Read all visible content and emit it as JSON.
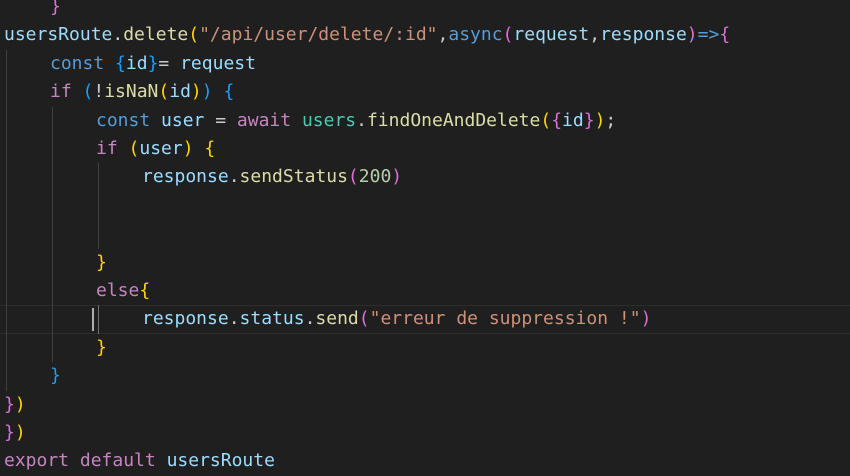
{
  "editor": {
    "lines": [
      {
        "indent": 1,
        "tokens": [
          {
            "t": "}",
            "c": "b2"
          }
        ]
      },
      {
        "indent": 0,
        "tokens": [
          {
            "t": "usersRoute",
            "c": "t-var"
          },
          {
            "t": ".",
            "c": "t-p"
          },
          {
            "t": "delete",
            "c": "t-fn"
          },
          {
            "t": "(",
            "c": "b1"
          },
          {
            "t": "\"/api/user/delete/:id\"",
            "c": "t-str"
          },
          {
            "t": ",",
            "c": "t-p"
          },
          {
            "t": "async",
            "c": "t-kw"
          },
          {
            "t": "(",
            "c": "b2"
          },
          {
            "t": "request",
            "c": "t-var"
          },
          {
            "t": ",",
            "c": "t-p"
          },
          {
            "t": "response",
            "c": "t-var"
          },
          {
            "t": ")",
            "c": "b2"
          },
          {
            "t": "=>",
            "c": "t-kw"
          },
          {
            "t": "{",
            "c": "b2"
          }
        ]
      },
      {
        "indent": 1,
        "tokens": [
          {
            "t": "const ",
            "c": "t-kw"
          },
          {
            "t": "{",
            "c": "b3"
          },
          {
            "t": "id",
            "c": "t-var"
          },
          {
            "t": "}",
            "c": "b3"
          },
          {
            "t": "= ",
            "c": "t-p"
          },
          {
            "t": "request",
            "c": "t-var"
          }
        ]
      },
      {
        "indent": 1,
        "tokens": [
          {
            "t": "if ",
            "c": "t-ctl"
          },
          {
            "t": "(",
            "c": "b3"
          },
          {
            "t": "!",
            "c": "t-p"
          },
          {
            "t": "isNaN",
            "c": "t-fn"
          },
          {
            "t": "(",
            "c": "b1"
          },
          {
            "t": "id",
            "c": "t-var"
          },
          {
            "t": ")",
            "c": "b1"
          },
          {
            "t": ") ",
            "c": "b3"
          },
          {
            "t": "{",
            "c": "b3"
          }
        ]
      },
      {
        "indent": 2,
        "tokens": [
          {
            "t": "const ",
            "c": "t-kw"
          },
          {
            "t": "user",
            "c": "t-var"
          },
          {
            "t": " = ",
            "c": "t-p"
          },
          {
            "t": "await ",
            "c": "t-ctl"
          },
          {
            "t": "users",
            "c": "t-obj"
          },
          {
            "t": ".",
            "c": "t-p"
          },
          {
            "t": "findOneAndDelete",
            "c": "t-fn"
          },
          {
            "t": "(",
            "c": "b1"
          },
          {
            "t": "{",
            "c": "b2"
          },
          {
            "t": "id",
            "c": "t-var"
          },
          {
            "t": "}",
            "c": "b2"
          },
          {
            "t": ")",
            "c": "b1"
          },
          {
            "t": ";",
            "c": "t-p"
          }
        ]
      },
      {
        "indent": 2,
        "tokens": [
          {
            "t": "if ",
            "c": "t-ctl"
          },
          {
            "t": "(",
            "c": "b1"
          },
          {
            "t": "user",
            "c": "t-var"
          },
          {
            "t": ") ",
            "c": "b1"
          },
          {
            "t": "{",
            "c": "b1"
          }
        ]
      },
      {
        "indent": 3,
        "tokens": [
          {
            "t": "response",
            "c": "t-var"
          },
          {
            "t": ".",
            "c": "t-p"
          },
          {
            "t": "sendStatus",
            "c": "t-fn"
          },
          {
            "t": "(",
            "c": "b2"
          },
          {
            "t": "200",
            "c": "t-num"
          },
          {
            "t": ")",
            "c": "b2"
          }
        ]
      },
      {
        "indent": 0,
        "tokens": []
      },
      {
        "indent": 0,
        "tokens": []
      },
      {
        "indent": 2,
        "tokens": [
          {
            "t": "}",
            "c": "b1"
          }
        ]
      },
      {
        "indent": 2,
        "tokens": [
          {
            "t": "else",
            "c": "t-ctl"
          },
          {
            "t": "{",
            "c": "b1"
          }
        ]
      },
      {
        "indent": 3,
        "current": true,
        "tokens": [
          {
            "t": "response",
            "c": "t-var"
          },
          {
            "t": ".",
            "c": "t-p"
          },
          {
            "t": "status",
            "c": "t-var"
          },
          {
            "t": ".",
            "c": "t-p"
          },
          {
            "t": "send",
            "c": "t-fn"
          },
          {
            "t": "(",
            "c": "b2"
          },
          {
            "t": "\"erreur de suppression !\"",
            "c": "t-str"
          },
          {
            "t": ")",
            "c": "b2"
          }
        ]
      },
      {
        "indent": 2,
        "tokens": [
          {
            "t": "}",
            "c": "b1"
          }
        ]
      },
      {
        "indent": 1,
        "tokens": [
          {
            "t": "}",
            "c": "b3"
          }
        ]
      },
      {
        "indent": 0,
        "tokens": [
          {
            "t": "}",
            "c": "b2"
          },
          {
            "t": ")",
            "c": "b1"
          }
        ]
      },
      {
        "indent": 0,
        "tokens": [
          {
            "t": "}",
            "c": "b2"
          },
          {
            "t": ")",
            "c": "b1"
          }
        ]
      },
      {
        "indent": 0,
        "tokens": [
          {
            "t": "export ",
            "c": "t-ctl"
          },
          {
            "t": "default ",
            "c": "t-ctl"
          },
          {
            "t": "usersRoute",
            "c": "t-var"
          }
        ]
      }
    ],
    "colors": {
      "background": "#1f1f1f",
      "indent_guide": "#404040",
      "active_indent_guide": "#707070"
    }
  }
}
